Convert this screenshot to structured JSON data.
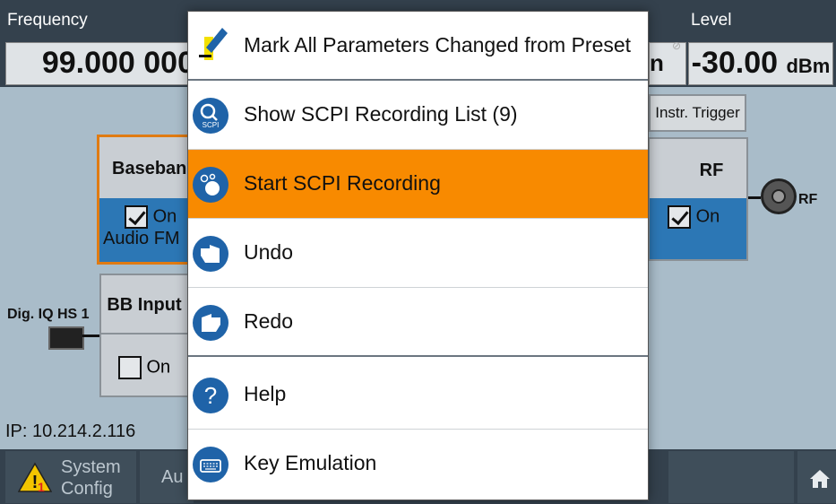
{
  "topbar": {
    "frequency_label": "Frequency",
    "frequency_value": "99.000 000",
    "level_label": "Level",
    "level_value": "-30.00",
    "level_unit": "dBm",
    "freq_unit_fragment": "n"
  },
  "blocks": {
    "instr_trigger": "Instr. Trigger",
    "baseband_label": "Baseban",
    "baseband_on": "On",
    "baseband_sub": "Audio FM",
    "bb_input_label": "BB Input",
    "bb_input_on": "On",
    "rf_label": "RF",
    "rf_on": "On",
    "rf_connector_label": "RF",
    "dig_iq_label": "Dig. IQ HS 1"
  },
  "status": {
    "ip": "IP: 10.214.2.116"
  },
  "softkeys": {
    "system_config_line1": "System",
    "system_config_line2": "Config",
    "au_fragment": "Au"
  },
  "menu": {
    "items": [
      {
        "label": "Mark All Parameters Changed from Preset",
        "icon": "mark-pen-icon"
      },
      {
        "label": "Show SCPI Recording List (9)",
        "icon": "scpi-search-icon"
      },
      {
        "label": "Start SCPI Recording",
        "icon": "record-icon",
        "highlighted": true
      },
      {
        "label": "Undo",
        "icon": "undo-icon"
      },
      {
        "label": "Redo",
        "icon": "redo-icon"
      },
      {
        "label": "Help",
        "icon": "help-icon"
      },
      {
        "label": "Key Emulation",
        "icon": "keyboard-icon"
      }
    ]
  },
  "colors": {
    "highlight": "#f88a00",
    "accent_blue": "#2c77b5",
    "icon_blue": "#1f63a8"
  }
}
